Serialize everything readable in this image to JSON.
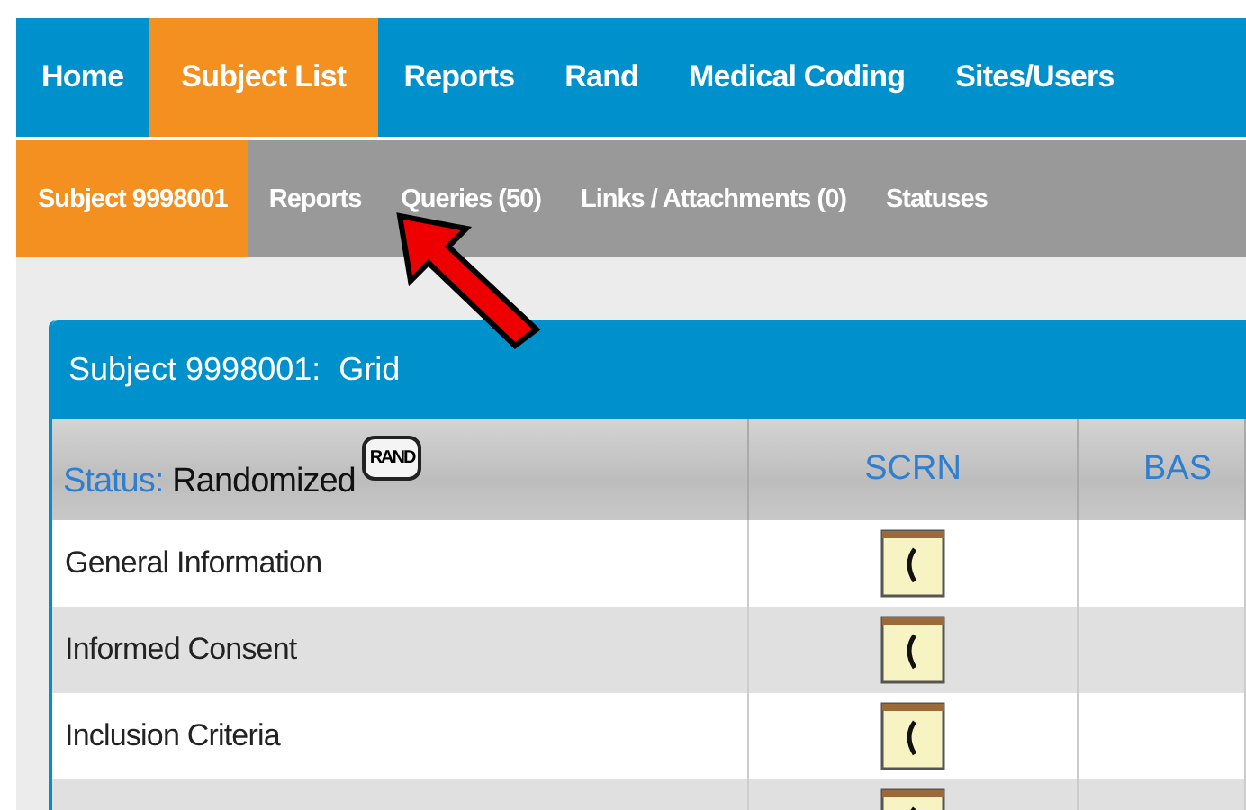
{
  "top_nav": [
    {
      "label": "Home",
      "selected": false
    },
    {
      "label": "Subject List",
      "selected": true
    },
    {
      "label": "Reports",
      "selected": false
    },
    {
      "label": "Rand",
      "selected": false
    },
    {
      "label": "Medical Coding",
      "selected": false
    },
    {
      "label": "Sites/Users",
      "selected": false
    }
  ],
  "sub_nav": [
    {
      "label": "Subject 9998001",
      "selected": true
    },
    {
      "label": "Reports",
      "selected": false
    },
    {
      "label": "Queries (50)",
      "selected": false
    },
    {
      "label": "Links / Attachments (0)",
      "selected": false
    },
    {
      "label": "Statuses",
      "selected": false
    }
  ],
  "panel": {
    "title": "Subject 9998001:  Grid",
    "status_label": "Status:",
    "status_value": "Randomized",
    "status_badge": "RAND",
    "columns": [
      "SCRN",
      "BAS"
    ],
    "rows": [
      {
        "label": "General Information"
      },
      {
        "label": "Informed Consent"
      },
      {
        "label": "Inclusion Criteria"
      },
      {}
    ]
  }
}
